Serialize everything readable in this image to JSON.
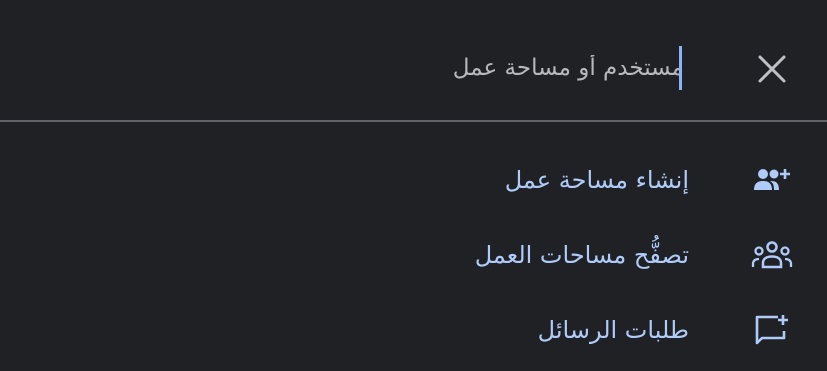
{
  "search": {
    "placeholder": "مستخدم أو مساحة عمل",
    "value": "",
    "close_icon": "close-icon"
  },
  "menu": {
    "items": [
      {
        "label": "إنشاء مساحة عمل",
        "icon": "group-add-icon"
      },
      {
        "label": "تصفُّح مساحات العمل",
        "icon": "groups-icon"
      },
      {
        "label": "طلبات الرسائل",
        "icon": "add-comment-icon"
      }
    ]
  },
  "colors": {
    "background": "#202124",
    "label": "#aecbfa",
    "icon": "#aecbfa",
    "caret": "#8ab4f8",
    "divider": "#5f6368",
    "placeholder": "#b7b9bd"
  }
}
